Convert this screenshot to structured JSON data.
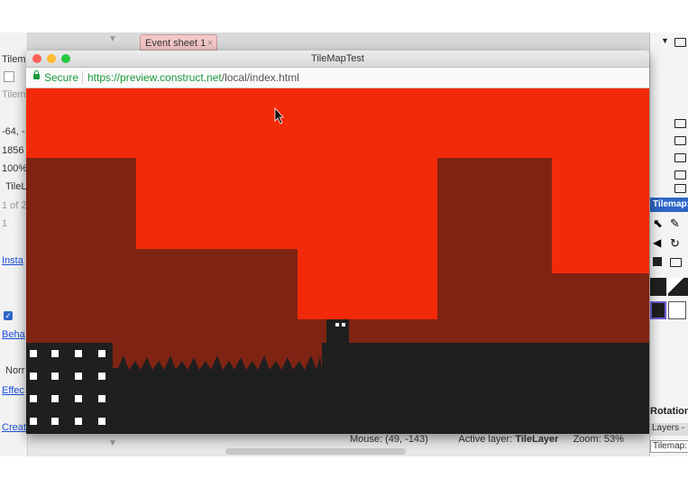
{
  "left_panel": {
    "items": [
      {
        "text": "Tilem",
        "link": false
      },
      {
        "text": "Tilem",
        "link": false
      },
      {
        "text": "-64, -",
        "link": false
      },
      {
        "text": "1856",
        "link": false
      },
      {
        "text": "100%",
        "link": false
      },
      {
        "text": "TileL",
        "link": false
      },
      {
        "text": "1 of 2",
        "link": false
      },
      {
        "text": "1",
        "link": false
      },
      {
        "text": "Insta",
        "link": true
      },
      {
        "text": "Beha",
        "link": true
      },
      {
        "text": "Norr",
        "link": false
      },
      {
        "text": "Effec",
        "link": true
      },
      {
        "text": "Creat",
        "link": true
      }
    ]
  },
  "tabs": {
    "event_sheet": "Event sheet 1",
    "close": "×"
  },
  "window": {
    "title": "TileMapTest",
    "secure_label": "Secure",
    "url_main": "https://preview.construct.net",
    "url_rest": "/local/index.html"
  },
  "right_panel": {
    "tilemap_tab": "Tilemap: T",
    "rotation_label": "Rotation",
    "layers_tab": "Layers - ",
    "tilemap_bottom": "Tilemap: "
  },
  "statusbar": {
    "mouse_label": "Mouse:",
    "mouse_value": "(49, -143)",
    "layer_label": "Active layer:",
    "layer_value": "TileLayer",
    "zoom_label": "Zoom:",
    "zoom_value": "53%"
  },
  "colors": {
    "sky": "#f32a0a",
    "hills": "#7f2413",
    "ground": "#1f1f1f",
    "window_light": "#ffffff"
  },
  "icons": [
    "lock-icon",
    "close-light",
    "minimize-light",
    "maximize-light",
    "folder-icon",
    "mouse-cursor-icon"
  ]
}
